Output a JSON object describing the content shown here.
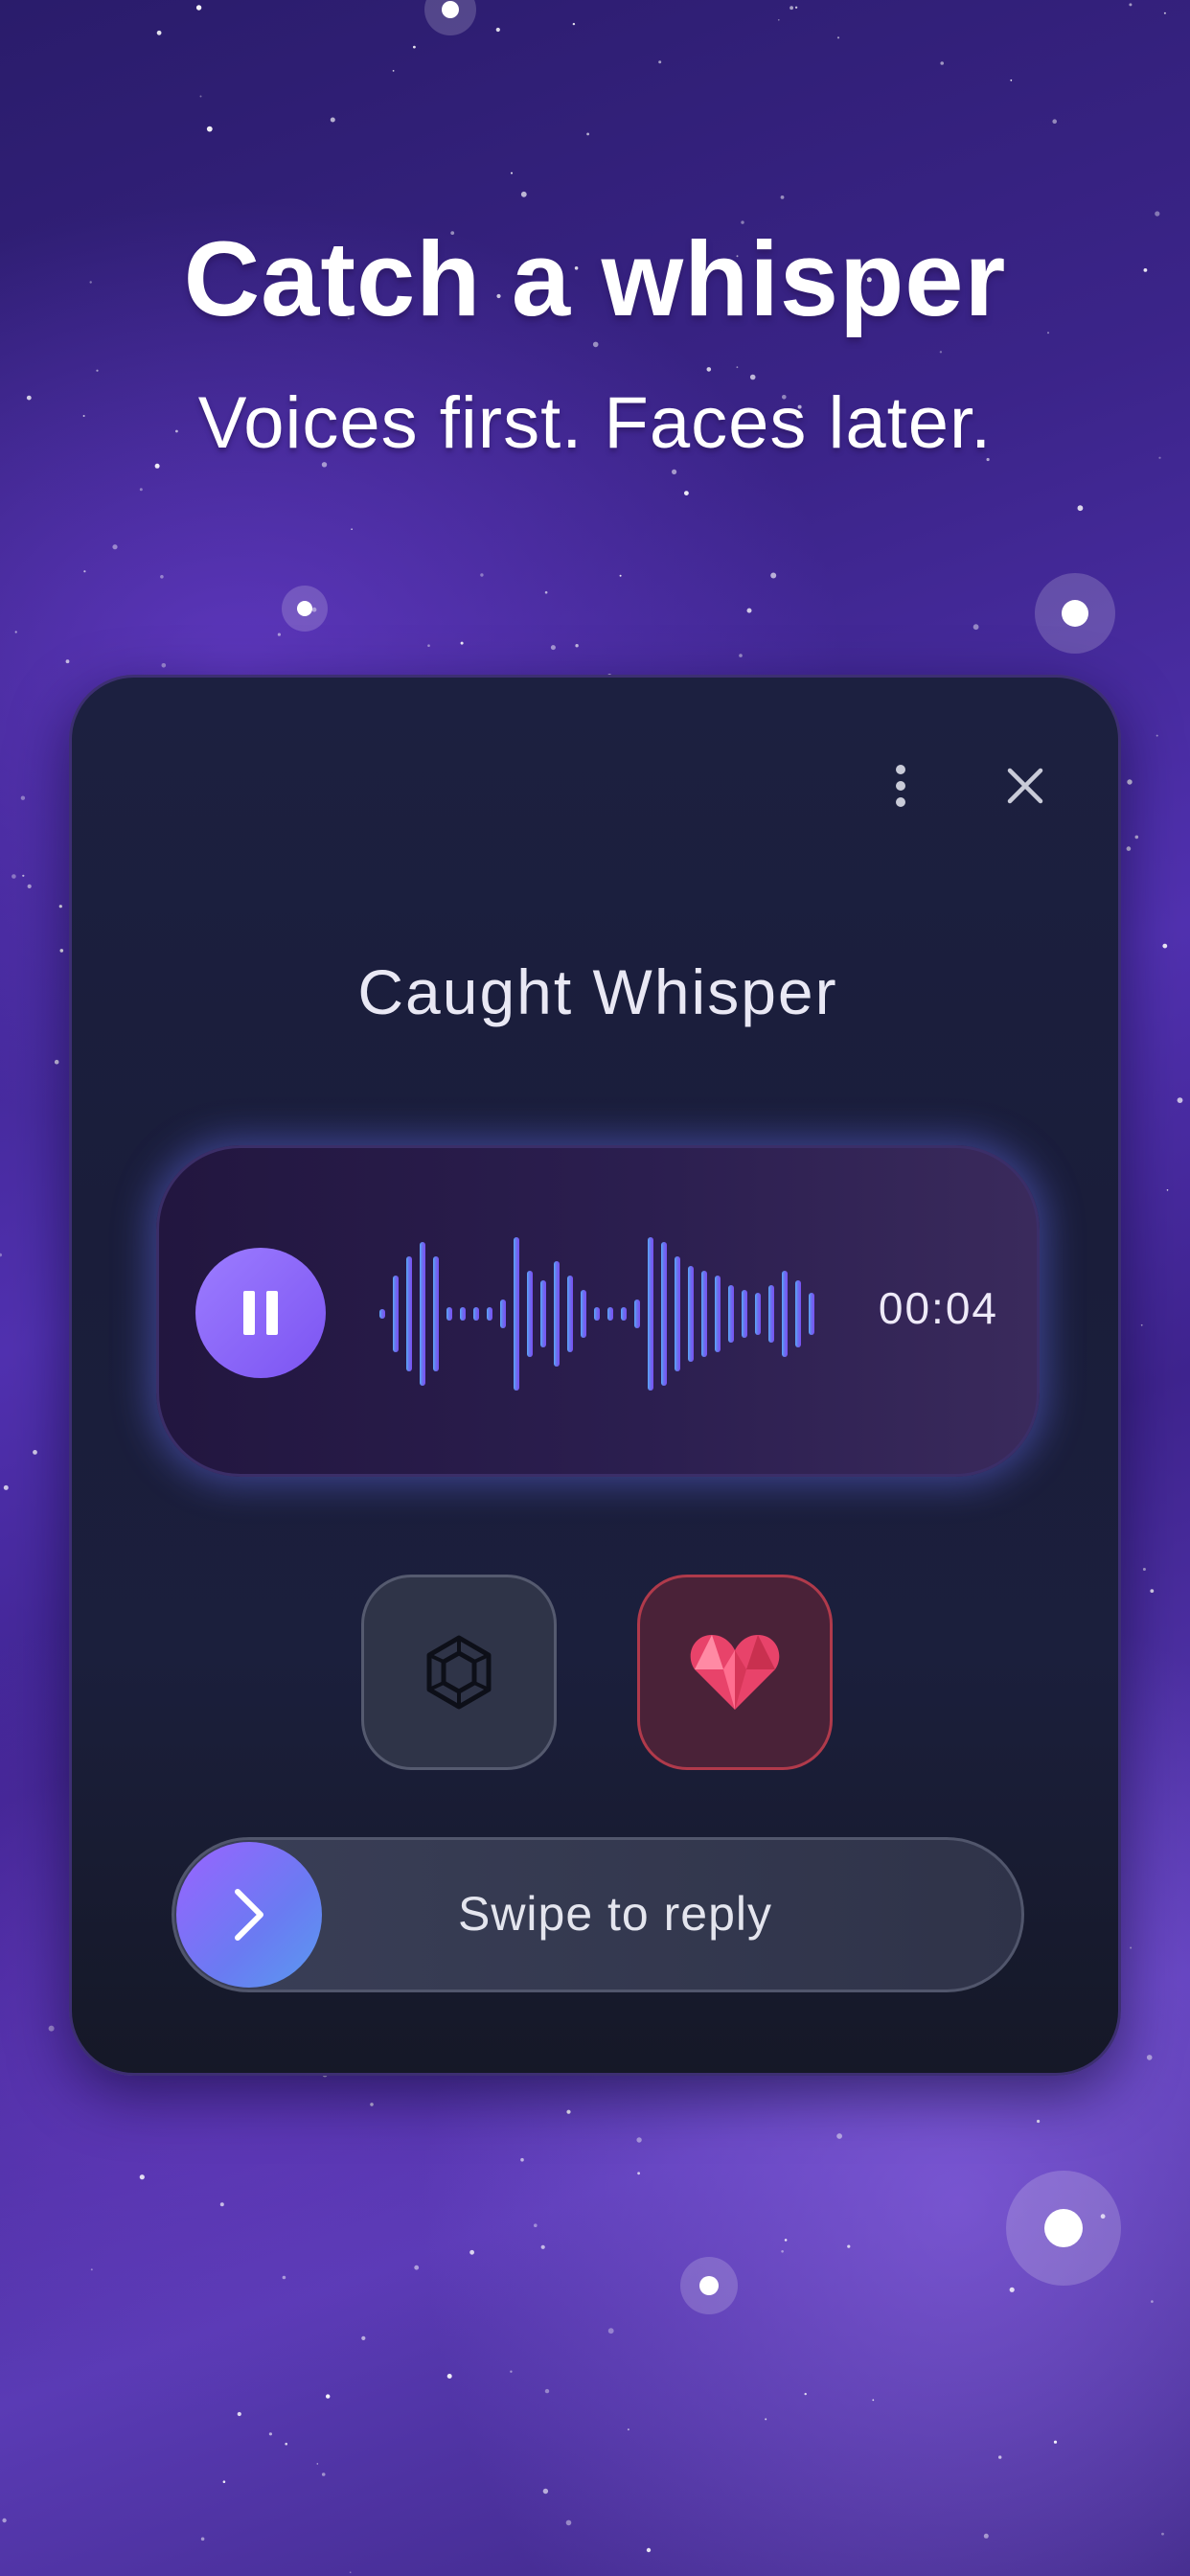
{
  "promo": {
    "headline": "Catch a whisper",
    "subline": "Voices first. Faces later."
  },
  "card": {
    "menu_icon": "more-vertical-icon",
    "close_icon": "close-icon",
    "title": "Caught Whisper",
    "player": {
      "state_icon": "pause-icon",
      "time": "00:04",
      "waveform_icon": "waveform-icon"
    },
    "actions": [
      {
        "icon": "gem-icon",
        "color": "#2f3448"
      },
      {
        "icon": "heart-icon",
        "color": "#e8436a"
      }
    ],
    "swipe": {
      "label": "Swipe to reply",
      "knob_icon": "chevron-right-icon"
    }
  },
  "colors": {
    "accent": "#8b63ff",
    "background": "#3b2489",
    "card": "#1b1f3c",
    "wave_start": "#5aa9f5",
    "wave_end": "#7a4ef0"
  }
}
